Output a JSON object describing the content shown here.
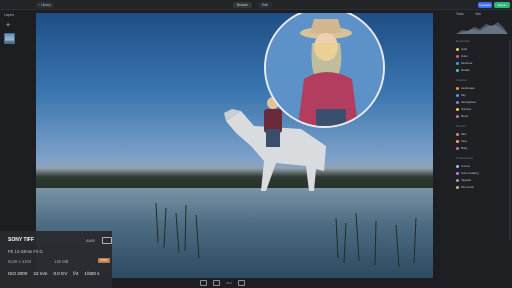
{
  "app": {
    "layers_title": "Layers",
    "back_label": "Library",
    "modes": {
      "browse": "Browse",
      "edit": "Edit"
    },
    "upgrade_label": "Upgrade",
    "export_label": "Export"
  },
  "info": {
    "camera": "SONY TIFF",
    "wb": "AWB",
    "lens": "FE 12-24mm F4 G",
    "resolution": "6240 x 4160",
    "file_size": "135 MB",
    "raw_badge": "RAW",
    "exif": {
      "iso": "ISO 2000",
      "focal": "22 mm",
      "ev": "0.0 EV",
      "aperture": "f/4",
      "shutter": "1/500 s"
    }
  },
  "bottombar": {
    "zoom": "44%"
  },
  "right_panel": {
    "tabs": [
      "Tools",
      "Info"
    ],
    "sections": [
      {
        "title": "Essentials",
        "items": [
          "Light",
          "Color",
          "Structure",
          "Details"
        ],
        "colors": [
          "#f0c94a",
          "#e05a7a",
          "#3aa0e8",
          "#5ac8a8"
        ]
      },
      {
        "title": "Creative",
        "items": [
          "Landscape",
          "Sky",
          "Atmosphere",
          "Sunrays",
          "Mood"
        ],
        "colors": [
          "#f09a3a",
          "#4aa0f0",
          "#8a7af0",
          "#f0d04a",
          "#e06ab0"
        ]
      },
      {
        "title": "Portrait",
        "items": [
          "Skin",
          "Face",
          "Body"
        ],
        "colors": [
          "#f07a6a",
          "#f0a07a",
          "#e06a8a"
        ]
      },
      {
        "title": "Professional",
        "items": [
          "Curves",
          "Color Grading",
          "Vignette",
          "Film Grain"
        ],
        "colors": [
          "#7ad0f0",
          "#c07af0",
          "#9aa0a8",
          "#d0b07a"
        ]
      }
    ]
  }
}
